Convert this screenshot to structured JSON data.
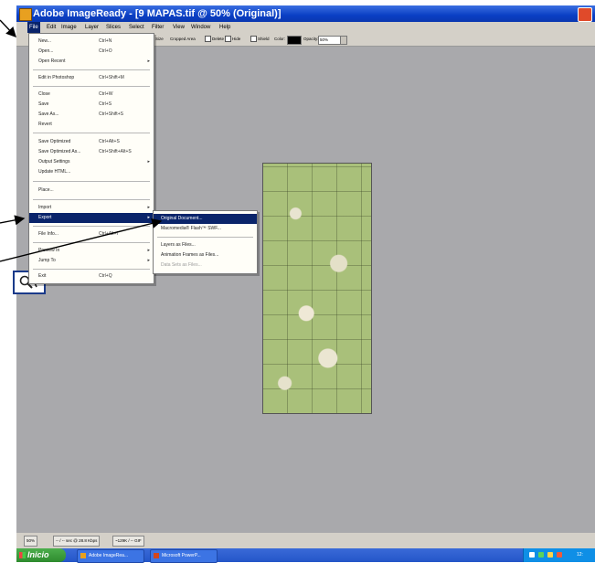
{
  "window": {
    "title": "Adobe ImageReady - [9 MAPAS.tif @ 50% (Original)]"
  },
  "menubar": {
    "items": [
      "File",
      "Edit",
      "Image",
      "Layer",
      "Slices",
      "Select",
      "Filter",
      "View",
      "Window",
      "Help"
    ]
  },
  "options_bar": {
    "size_label": "Size",
    "cropped_area_label": "Cropped Area",
    "delete_label": "Delete",
    "hide_label": "Hide",
    "shield_label": "Shield",
    "color_label": "Color:",
    "opacity_label": "Opacity:",
    "opacity_value": "50%"
  },
  "file_menu": {
    "items": [
      {
        "label": "New...",
        "shortcut": "Ctrl+N"
      },
      {
        "label": "Open...",
        "shortcut": "Ctrl+O"
      },
      {
        "label": "Open Recent",
        "submenu": true
      },
      {
        "label": "Edit in Photoshop",
        "shortcut": "Ctrl+Shift+M"
      },
      {
        "label": "Close",
        "shortcut": "Ctrl+W"
      },
      {
        "label": "Save",
        "shortcut": "Ctrl+S"
      },
      {
        "label": "Save As...",
        "shortcut": "Ctrl+Shift+S"
      },
      {
        "label": "Revert"
      },
      {
        "label": "Save Optimized",
        "shortcut": "Ctrl+Alt+S"
      },
      {
        "label": "Save Optimized As...",
        "shortcut": "Ctrl+Shift+Alt+S"
      },
      {
        "label": "Output Settings",
        "submenu": true
      },
      {
        "label": "Update HTML..."
      },
      {
        "label": "Place..."
      },
      {
        "label": "Import",
        "submenu": true
      },
      {
        "label": "Export",
        "submenu": true
      },
      {
        "label": "File Info...",
        "shortcut": "Ctrl+Alt+I"
      },
      {
        "label": "Preview In",
        "submenu": true
      },
      {
        "label": "Jump To",
        "submenu": true
      },
      {
        "label": "Exit",
        "shortcut": "Ctrl+Q"
      }
    ]
  },
  "export_submenu": {
    "items": [
      {
        "label": "Original Document..."
      },
      {
        "label": "Macromedia® Flash™ SWF..."
      },
      {
        "label": "Layers as Files..."
      },
      {
        "label": "Animation Frames as Files..."
      },
      {
        "label": "Data Sets as Files..."
      }
    ]
  },
  "status_bar": {
    "zoom": "50%",
    "file_info": "-- / -- sec @ 28.8 Kbps",
    "size_info": "~129K / -- GIF"
  },
  "taskbar": {
    "start_label": "Inicio",
    "tasks": [
      "Adobe ImageRea...",
      "Microsoft PowerP..."
    ],
    "clock": "12:"
  },
  "colors": {
    "title_blue": "#0a3fc4",
    "menu_highlight": "#0a246a",
    "workspace_gray": "#a9a9ac",
    "taskbar_blue": "#2456c8",
    "start_green": "#2e8b2e"
  }
}
